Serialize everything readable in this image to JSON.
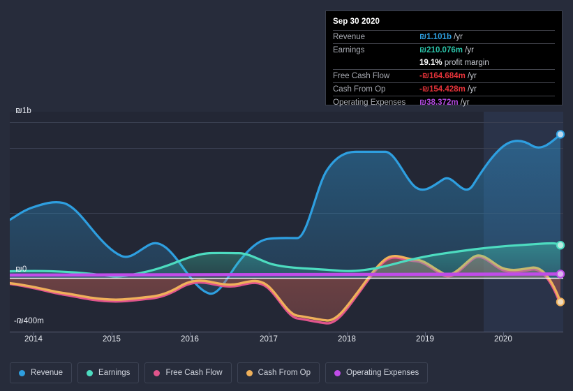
{
  "tooltip": {
    "title": "Sep 30 2020",
    "rows": [
      {
        "label": "Revenue",
        "amount": "₪1.101b",
        "unit": "/yr",
        "color": "#2e9fe0"
      },
      {
        "label": "Earnings",
        "amount": "₪210.076m",
        "unit": "/yr",
        "color": "#2bc4a9"
      },
      {
        "label": "",
        "amount": "19.1%",
        "unit": "profit margin",
        "color": "#ffffff",
        "is_margin": true
      },
      {
        "label": "Free Cash Flow",
        "amount": "-₪164.684m",
        "unit": "/yr",
        "color": "#e8333a"
      },
      {
        "label": "Cash From Op",
        "amount": "-₪154.428m",
        "unit": "/yr",
        "color": "#e8333a"
      },
      {
        "label": "Operating Expenses",
        "amount": "₪38.372m",
        "unit": "/yr",
        "color": "#b24be0"
      }
    ]
  },
  "legend": {
    "items": [
      {
        "label": "Revenue",
        "color": "#2e9fe0"
      },
      {
        "label": "Earnings",
        "color": "#4ddcc0"
      },
      {
        "label": "Free Cash Flow",
        "color": "#e0558c"
      },
      {
        "label": "Cash From Op",
        "color": "#efb05a"
      },
      {
        "label": "Operating Expenses",
        "color": "#c04ce8"
      }
    ]
  },
  "chart_data": {
    "type": "area",
    "title": "",
    "xlabel": "",
    "ylabel": "",
    "currency": "₪",
    "grid": true,
    "legend_position": "bottom",
    "y_ticks": [
      "₪1b",
      "₪0",
      "-₪400m"
    ],
    "y_tick_values": [
      1000,
      0,
      -400
    ],
    "ylim": [
      -400,
      1200
    ],
    "y_unit": "millions of ₪",
    "x_ticks": [
      "2014",
      "2015",
      "2016",
      "2017",
      "2018",
      "2019",
      "2020"
    ],
    "xlim": [
      "2013.75",
      "2020.85"
    ],
    "x": [
      2013.75,
      2014.0,
      2014.25,
      2014.5,
      2014.75,
      2015.0,
      2015.25,
      2015.5,
      2015.75,
      2016.0,
      2016.25,
      2016.5,
      2016.75,
      2017.0,
      2017.25,
      2017.5,
      2017.75,
      2018.0,
      2018.25,
      2018.5,
      2018.75,
      2019.0,
      2019.25,
      2019.5,
      2019.75,
      2020.0,
      2020.25,
      2020.5,
      2020.75
    ],
    "series": [
      {
        "name": "Revenue",
        "color": "#2e9fe0",
        "fill": true,
        "values": [
          418,
          485,
          520,
          512,
          455,
          378,
          398,
          415,
          352,
          268,
          255,
          298,
          358,
          410,
          432,
          435,
          690,
          770,
          805,
          805,
          640,
          690,
          660,
          700,
          845,
          910,
          930,
          900,
          1101
        ]
      },
      {
        "name": "Earnings",
        "color": "#4ddcc0",
        "fill": true,
        "values": [
          42,
          45,
          44,
          44,
          42,
          40,
          38,
          32,
          22,
          18,
          20,
          30,
          44,
          58,
          86,
          118,
          140,
          150,
          148,
          142,
          128,
          120,
          122,
          138,
          155,
          170,
          182,
          196,
          210
        ]
      },
      {
        "name": "Free Cash Flow",
        "color": "#e0558c",
        "fill": true,
        "values": [
          -38,
          -45,
          -62,
          -78,
          -82,
          -98,
          -120,
          -128,
          -122,
          -108,
          -96,
          -60,
          -30,
          -62,
          -20,
          -58,
          -150,
          -248,
          -280,
          -100,
          60,
          112,
          172,
          178,
          80,
          158,
          52,
          -35,
          -165
        ]
      },
      {
        "name": "Cash From Op",
        "color": "#efb05a",
        "fill": true,
        "values": [
          -34,
          -40,
          -58,
          -74,
          -78,
          -94,
          -116,
          -124,
          -118,
          -104,
          -92,
          -54,
          -24,
          -55,
          -14,
          -52,
          -145,
          -242,
          -274,
          -94,
          66,
          120,
          180,
          186,
          88,
          166,
          60,
          -28,
          -154
        ]
      },
      {
        "name": "Operating Expenses",
        "color": "#c04ce8",
        "fill": false,
        "values": [
          18,
          18,
          19,
          19,
          20,
          21,
          22,
          24,
          26,
          28,
          30,
          31,
          32,
          33,
          34,
          34,
          35,
          35,
          35,
          35,
          36,
          36,
          36,
          36,
          37,
          37,
          37,
          38,
          38
        ]
      }
    ],
    "endpoint_markers": [
      {
        "series": "Revenue",
        "value": 1101,
        "color": "#2e9fe0"
      },
      {
        "series": "Earnings",
        "value": 210,
        "color": "#4ddcc0"
      },
      {
        "series": "Operating Expenses",
        "value": 38,
        "color": "#c04ce8"
      },
      {
        "series": "Cash From Op",
        "value": -154,
        "color": "#efb05a"
      }
    ],
    "highlight_band": {
      "from": "2019.9",
      "to": "2020.85",
      "note": "shaded forecast region"
    }
  }
}
